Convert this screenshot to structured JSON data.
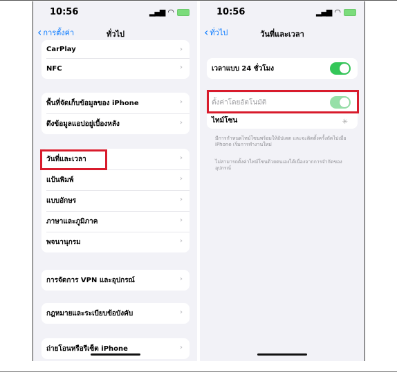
{
  "left_screen": {
    "status": {
      "time": "10:56"
    },
    "nav": {
      "back_label": "การตั้งค่า",
      "title": "ทั่วไป"
    },
    "groups": [
      [
        "CarPlay",
        "NFC"
      ],
      [
        "พื้นที่จัดเก็บข้อมูลของ iPhone",
        "ดึงข้อมูลแอปอยู่เบื้องหลัง"
      ],
      [
        "วันที่และเวลา",
        "แป้นพิมพ์",
        "แบบอักษร",
        "ภาษาและภูมิภาค",
        "พจนานุกรม"
      ],
      [
        "การจัดการ VPN และอุปกรณ์"
      ],
      [
        "กฎหมายและระเบียบข้อบังคับ"
      ],
      [
        "ถ่ายโอนหรือรีเซ็ต iPhone"
      ]
    ]
  },
  "right_screen": {
    "status": {
      "time": "10:56"
    },
    "nav": {
      "back_label": "ทั่วไป",
      "title": "วันที่และเวลา"
    },
    "rows": {
      "h24_label": "เวลาแบบ 24 ชั่วโมง",
      "auto_label": "ตั้งค่าโดยอัตโนมัติ",
      "timezone_label": "ไทม์โซน"
    },
    "notes": {
      "note1": "มีการกำหนดไทม์โซนพร้อมให้อัปเดต และจะติดตั้งครั้งถัดไปเมื่อ iPhone เริ่มการทำงานใหม่",
      "note2": "ไม่สามารถตั้งค่าไทม์โซนด้วยตนเองได้เนื่องจากการจำกัดของอุปกรณ์"
    },
    "toggles": {
      "h24_on": true,
      "auto_on": true
    }
  },
  "colors": {
    "accent": "#0a7aff",
    "toggle_on": "#34c759",
    "highlight": "#d81b2c"
  }
}
